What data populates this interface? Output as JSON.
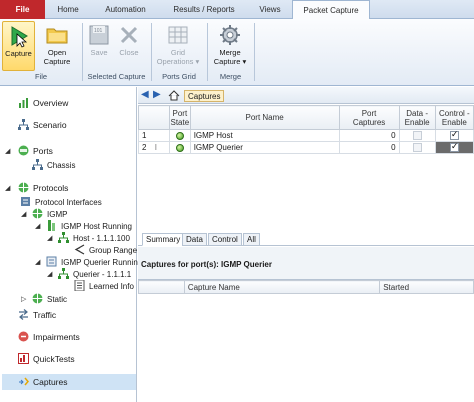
{
  "tabs": {
    "file": "File",
    "home": "Home",
    "automation": "Automation",
    "results": "Results / Reports",
    "views": "Views",
    "packet_capture": "Packet Capture"
  },
  "ribbon": {
    "capture_label": "Capture",
    "open_capture_line1": "Open",
    "open_capture_line2": "Capture",
    "save_label": "Save",
    "close_label": "Close",
    "grid_ops_line1": "Grid",
    "grid_ops_line2": "Operations ▾",
    "merge_line1": "Merge",
    "merge_line2": "Capture ▾",
    "group_file": "File",
    "group_selected": "Selected Capture",
    "group_ports": "Ports Grid",
    "group_merge": "Merge"
  },
  "nav": {
    "overview": "Overview",
    "scenario": "Scenario",
    "ports": "Ports",
    "chassis": "Chassis",
    "protocols": "Protocols",
    "protocol_interfaces": "Protocol Interfaces",
    "igmp": "IGMP",
    "igmp_host_running": "IGMP Host Running",
    "host": "Host - 1.1.1.100",
    "group_range": "Group Range",
    "igmp_querier_running": "IGMP Querier Running",
    "querier": "Querier - 1.1.1.1",
    "learned_info": "Learned Info",
    "static": "Static",
    "traffic": "Traffic",
    "impairments": "Impairments",
    "quicktests": "QuickTests",
    "captures": "Captures"
  },
  "breadcrumb": {
    "label": "Captures"
  },
  "ports_grid": {
    "headers": {
      "port_state_1": "Port",
      "port_state_2": "State",
      "port_name": "Port Name",
      "port_caps_1": "Port",
      "port_caps_2": "Captures",
      "data_1": "Data -",
      "data_2": "Enable",
      "ctrl_1": "Control -",
      "ctrl_2": "Enable"
    },
    "rows": [
      {
        "num": "1",
        "name": "IGMP Host",
        "captures": "0"
      },
      {
        "num": "2",
        "name": "IGMP Querier",
        "captures": "0"
      }
    ]
  },
  "subtabs": {
    "summary": "Summary",
    "data": "Data",
    "control": "Control",
    "all": "All"
  },
  "captures_for": "Captures for port(s): IGMP Querier",
  "capture_table": {
    "col_name": "Capture Name",
    "col_started": "Started"
  },
  "colors": {
    "file_tab": "#c0282c",
    "selection": "#cfe3f5",
    "accent": "#9fb6d2"
  }
}
